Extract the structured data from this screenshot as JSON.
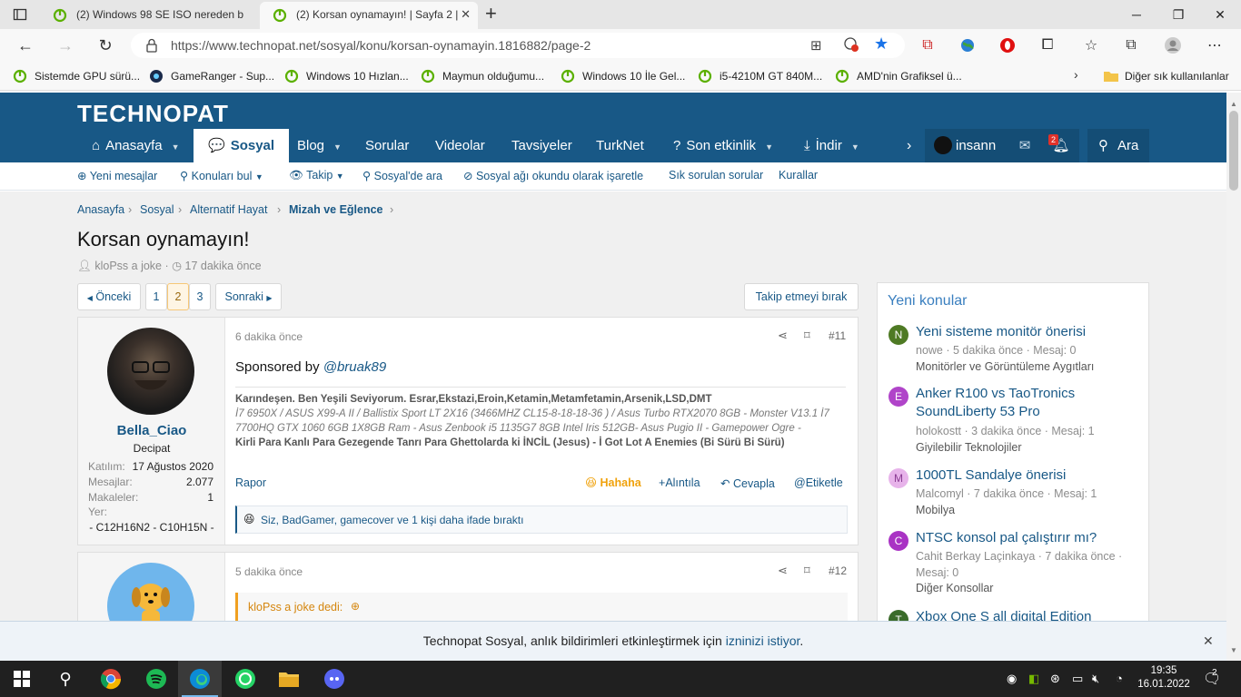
{
  "browser": {
    "tabs": [
      {
        "label": "(2) Windows 98 SE ISO nereden b",
        "active": false
      },
      {
        "label": "(2) Korsan oynamayın! | Sayfa 2 |",
        "active": true
      }
    ],
    "url": "https://www.technopat.net/sosyal/konu/korsan-oynamayin.1816882/page-2",
    "favorites": [
      "Sistemde GPU sürü...",
      "GameRanger - Sup...",
      "Windows 10 Hızlan...",
      "Maymun olduğumu...",
      "Windows 10 İle Gel...",
      "i5-4210M GT 840M...",
      "AMD'nin Grafiksel ü..."
    ],
    "other_favorites": "Diğer sık kullanılanlar"
  },
  "site": {
    "logo": "TECHNOPAT",
    "nav": [
      {
        "label": "Anasayfa",
        "caret": true
      },
      {
        "label": "Sosyal",
        "caret": false,
        "selected": true
      },
      {
        "label": "Blog",
        "caret": true
      },
      {
        "label": "Sorular",
        "caret": false
      },
      {
        "label": "Videolar",
        "caret": false
      },
      {
        "label": "Tavsiyeler",
        "caret": false
      },
      {
        "label": "TurkNet",
        "caret": false
      },
      {
        "label": "Son etkinlik",
        "caret": true
      },
      {
        "label": "İndir",
        "caret": true
      }
    ],
    "user": "insann",
    "alert_count": "2",
    "search": "Ara",
    "subnav": [
      "Yeni mesajlar",
      "Konuları bul",
      "Takip",
      "Sosyal'de ara",
      "Sosyal ağı okundu olarak işaretle",
      "Sık sorulan sorular",
      "Kurallar"
    ]
  },
  "breadcrumb": [
    "Anasayfa",
    "Sosyal",
    "Alternatif Hayat",
    "Mizah ve Eğlence"
  ],
  "thread": {
    "title": "Korsan oynamayın!",
    "author": "kloPss a joke",
    "time": "17 dakika önce",
    "prev": "Önceki",
    "next": "Sonraki",
    "pages": [
      "1",
      "2",
      "3"
    ],
    "current_page": "2",
    "unwatch": "Takip etmeyi bırak"
  },
  "posts": [
    {
      "time": "6 dakika önce",
      "number": "#11",
      "username": "Bella_Ciao",
      "rank": "Decipat",
      "joined_label": "Katılım:",
      "joined": "17 Ağustos 2020",
      "messages_label": "Mesajlar:",
      "messages": "2.077",
      "articles_label": "Makaleler:",
      "articles": "1",
      "location_label": "Yer:",
      "location": "- C12H16N2 - C10H15N -",
      "content_prefix": "Sponsored by ",
      "mention": "@bruak89",
      "sig_line1": "Karındeşen. Ben Yeşili Seviyorum. Esrar,Ekstazi,Eroin,Ketamin,Metamfetamin,Arsenik,LSD,DMT",
      "sig_line2": "İ7 6950X / ASUS X99-A II / Ballistix Sport LT 2X16 (3466MHZ CL15-8-18-18-36 ) / Asus Turbo RTX2070 8GB - Monster V13.1 İ7 7700HQ GTX 1060 6GB 1X8GB Ram - Asus Zenbook i5 1135G7 8GB Intel Iris 512GB- Asus Pugio II - Gamepower Ogre -",
      "sig_line3": "Kirli Para Kanlı Para Gezegende Tanrı Para Ghettolarda ki İNCİL (Jesus) - İ Got Lot A Enemies (Bi Sürü Bi Sürü)",
      "report": "Rapor",
      "reaction": "Hahaha",
      "quote": "Alıntıla",
      "reply": "Cevapla",
      "tag": "Etiketle",
      "reactions_text": "Siz, BadGamer, gamecover ve 1 kişi daha ifade bıraktı"
    },
    {
      "time": "5 dakika önce",
      "number": "#12",
      "quote_author": "kloPss a joke dedi:"
    }
  ],
  "sidebar": {
    "title": "Yeni konular",
    "items": [
      {
        "initial": "N",
        "color": "#4e7a24",
        "title": "Yeni sisteme monitör önerisi",
        "meta1": "nowe · 5 dakika önce · Mesaj: 0",
        "meta2": "",
        "forum": "Monitörler ve Görüntüleme Aygıtları"
      },
      {
        "initial": "E",
        "color": "#b044c9",
        "title": "Anker R100 vs TaoTronics SoundLiberty 53 Pro",
        "meta1": "holokostt · 3 dakika önce · Mesaj: 1",
        "meta2": "",
        "forum": "Giyilebilir Teknolojiler"
      },
      {
        "initial": "M",
        "color": "#e7b3ea",
        "title": "1000TL Sandalye önerisi",
        "meta1": "Malcomyl · 7 dakika önce · Mesaj: 1",
        "meta2": "",
        "forum": "Mobilya"
      },
      {
        "initial": "C",
        "color": "#a933c4",
        "title": "NTSC konsol pal çalıştırır mı?",
        "meta1": "Cahit Berkay Laçinkaya · 7 dakika önce ·",
        "meta2": "Mesaj: 0",
        "forum": "Diğer Konsollar"
      },
      {
        "initial": "T",
        "color": "#3a6b2a",
        "title": "Xbox One S all digital Edition",
        "meta1": "",
        "meta2": "",
        "forum": ""
      }
    ]
  },
  "notification": {
    "text": "Technopat Sosyal, anlık bildirimleri etkinleştirmek için ",
    "link": "izninizi istiyor",
    "end": "."
  },
  "taskbar": {
    "time": "19:35",
    "date": "16.01.2022",
    "notif_count": "2"
  }
}
